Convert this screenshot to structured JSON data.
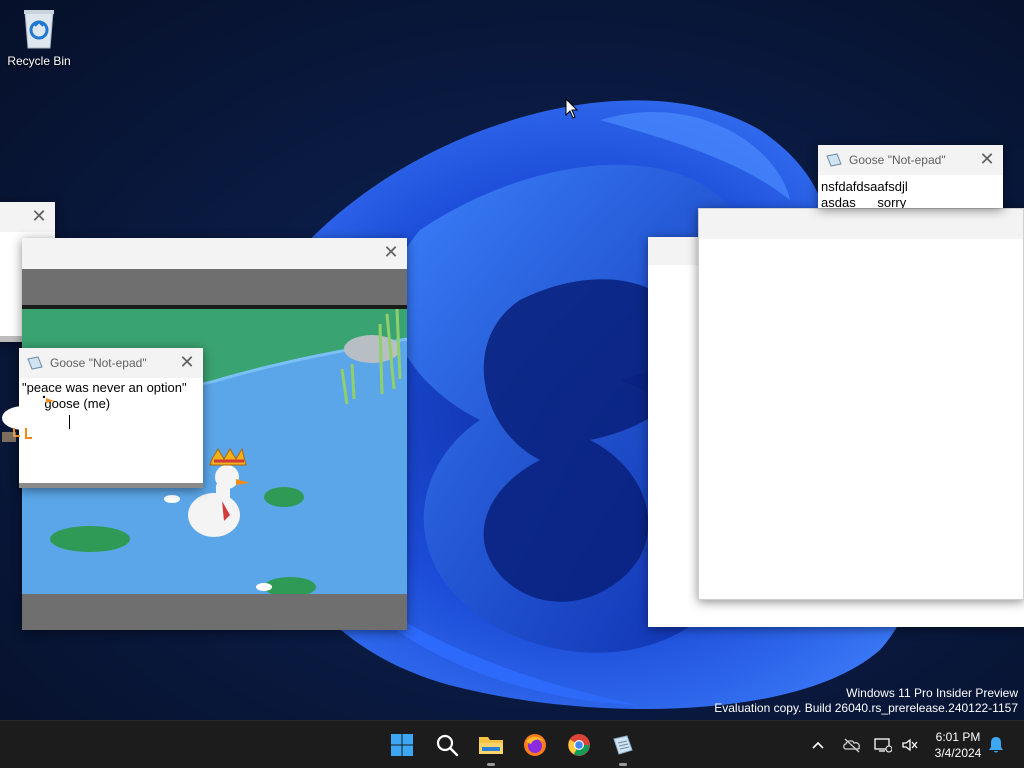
{
  "desktop": {
    "icons": [
      {
        "label": "Recycle Bin",
        "icon": "recycle-bin-icon"
      }
    ]
  },
  "windows": {
    "small_left_stub": {
      "close_label": "✕"
    },
    "video_window": {
      "close_label": "✕"
    },
    "notepad_left": {
      "title": "Goose \"Not-epad\"",
      "close_label": "✕",
      "text_line1": "\"peace was never an option\"",
      "text_line2": "    - goose (me)"
    },
    "notepad_right": {
      "title": "Goose \"Not-epad\"",
      "close_label": "✕",
      "text_line1": "nsfdafdsaafsdjl",
      "text_line2": "asdas      sorry"
    }
  },
  "watermark": {
    "line1": "Windows 11 Pro Insider Preview",
    "line2": "Evaluation copy. Build 26040.rs_prerelease.240122-1157"
  },
  "taskbar": {
    "apps": [
      "start-icon",
      "search-icon",
      "file-explorer-icon",
      "firefox-icon",
      "chrome-icon",
      "notepad-icon"
    ],
    "tray": {
      "time": "6:01 PM",
      "date": "3/4/2024"
    }
  },
  "colors": {
    "taskbar": "#1c1c1c",
    "wallpaper_accent": "#1f5bff",
    "pond": "#5aa6e8",
    "grass": "#3aa372"
  }
}
